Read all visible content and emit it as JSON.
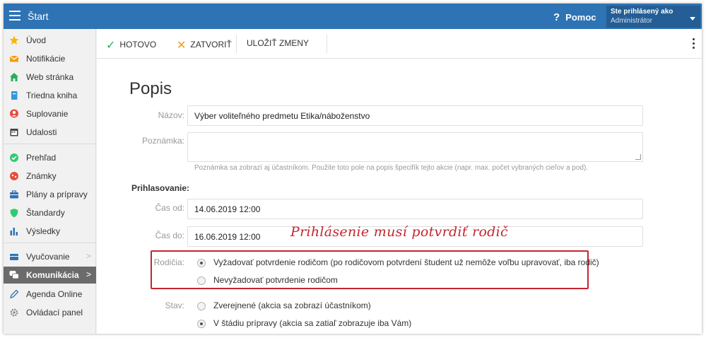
{
  "app": {
    "title": "Štart"
  },
  "header": {
    "help_label": "Pomoc",
    "help_glyph": "?",
    "user_caption": "Ste prihlásený ako",
    "user_role": "Administrátor"
  },
  "sidebar": {
    "items": [
      {
        "label": "Úvod",
        "icon": "star-icon",
        "color": "#f5b800"
      },
      {
        "label": "Notifikácie",
        "icon": "envelope-icon",
        "color": "#f39c12"
      },
      {
        "label": "Web stránka",
        "icon": "home-icon",
        "color": "#27ae60"
      },
      {
        "label": "Triedna kniha",
        "icon": "book-icon",
        "color": "#3498db"
      },
      {
        "label": "Suplovanie",
        "icon": "person-icon",
        "color": "#e74c3c"
      },
      {
        "label": "Udalosti",
        "icon": "calendar-icon",
        "color": "#444444"
      },
      {
        "label": "Prehľad",
        "icon": "check-circle-icon",
        "color": "#2ecc71"
      },
      {
        "label": "Známky",
        "icon": "grade-icon",
        "color": "#e74c3c"
      },
      {
        "label": "Plány a prípravy",
        "icon": "briefcase-icon",
        "color": "#2e73b3"
      },
      {
        "label": "Štandardy",
        "icon": "shield-icon",
        "color": "#2ecc71"
      },
      {
        "label": "Výsledky",
        "icon": "bar-chart-icon",
        "color": "#2e73b3"
      },
      {
        "label": "Vyučovanie",
        "icon": "folder-icon",
        "color": "#2e73b3",
        "chevron": ">"
      },
      {
        "label": "Komunikácia",
        "icon": "chat-icon",
        "color": "#ffffff",
        "chevron": ">",
        "active": true
      },
      {
        "label": "Agenda Online",
        "icon": "pencil-icon",
        "color": "#2e73b3"
      },
      {
        "label": "Ovládací panel",
        "icon": "gear-icon",
        "color": "#888888"
      }
    ]
  },
  "toolbar": {
    "done_label": "HOTOVO",
    "close_label": "ZATVORIŤ",
    "save_label": "ULOŽIŤ ZMENY"
  },
  "form": {
    "title": "Popis",
    "name_label": "Názov:",
    "name_value": "Výber voliteľného predmetu Etika/náboženstvo",
    "note_label": "Poznámka:",
    "note_value": "",
    "note_hint": "Poznámka sa zobrazí aj účastníkom. Použite toto pole na popis špecifík tejto akcie (napr. max. počet vybraných cieľov a pod).",
    "signup_section": "Prihlasovanie:",
    "from_label": "Čas od:",
    "from_value": "14.06.2019 12:00",
    "to_label": "Čas do:",
    "to_value": "16.06.2019 12:00",
    "parents_label": "Rodičia:",
    "parents_options": [
      {
        "label": "Vyžadovať potvrdenie rodičom (po rodičovom potvrdení študent už nemôže voľbu upravovať, iba rodič)",
        "checked": true
      },
      {
        "label": "Nevyžadovať potvrdenie rodičom",
        "checked": false
      }
    ],
    "state_label": "Stav:",
    "state_options": [
      {
        "label": "Zverejnené (akcia sa zobrazí účastníkom)",
        "checked": false
      },
      {
        "label": "V štádiu prípravy (akcia sa zatiaľ zobrazuje iba Vám)",
        "checked": true
      }
    ]
  },
  "annotation": {
    "text": "Prihlásenie musí potvrdiť rodič"
  },
  "colors": {
    "header": "#2e73b3",
    "accent_red": "#c3262e",
    "done_check": "#27ae60",
    "close_x": "#f39c12"
  }
}
